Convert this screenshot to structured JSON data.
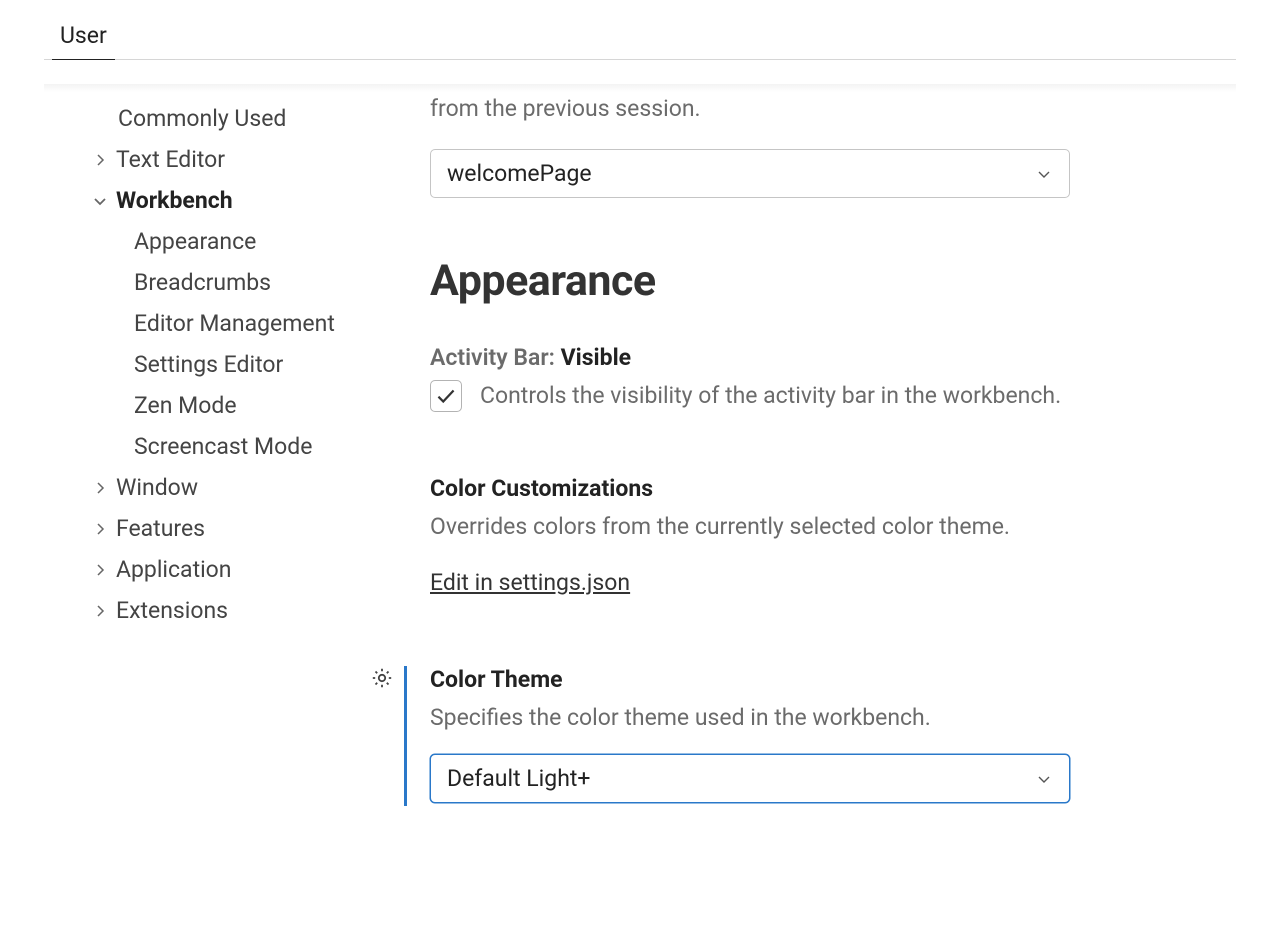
{
  "tabs": {
    "user": "User"
  },
  "sidebar": {
    "commonly_used": "Commonly Used",
    "text_editor": "Text Editor",
    "workbench": "Workbench",
    "workbench_children": {
      "appearance": "Appearance",
      "breadcrumbs": "Breadcrumbs",
      "editor_management": "Editor Management",
      "settings_editor": "Settings Editor",
      "zen_mode": "Zen Mode",
      "screencast_mode": "Screencast Mode"
    },
    "window": "Window",
    "features": "Features",
    "application": "Application",
    "extensions": "Extensions"
  },
  "main": {
    "startup_desc_partial": "from the previous session.",
    "startup_select": "welcomePage",
    "appearance_heading": "Appearance",
    "activity_bar": {
      "label_prefix": "Activity Bar:",
      "label_suffix": "Visible",
      "desc": "Controls the visibility of the activity bar in the workbench."
    },
    "color_customizations": {
      "title": "Color Customizations",
      "desc": "Overrides colors from the currently selected color theme.",
      "link": "Edit in settings.json"
    },
    "color_theme": {
      "title": "Color Theme",
      "desc": "Specifies the color theme used in the workbench.",
      "value": "Default Light+"
    }
  }
}
